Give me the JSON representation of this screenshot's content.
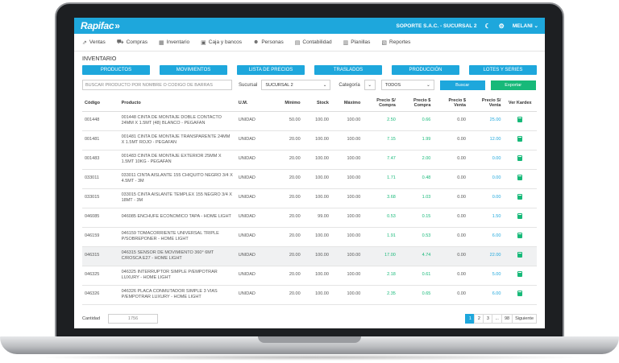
{
  "header": {
    "brand": "Rapifac",
    "company": "SOPORTE S.A.C. - SUCURSAL 2",
    "user": "MELANI"
  },
  "menu": [
    {
      "label": "Ventas",
      "icon": "chart-icon"
    },
    {
      "label": "Compras",
      "icon": "cart-icon"
    },
    {
      "label": "Inventario",
      "icon": "boxes-icon"
    },
    {
      "label": "Caja y bancos",
      "icon": "cash-icon"
    },
    {
      "label": "Personas",
      "icon": "people-icon"
    },
    {
      "label": "Contabilidad",
      "icon": "ledger-icon"
    },
    {
      "label": "Planillas",
      "icon": "sheet-icon"
    },
    {
      "label": "Reportes",
      "icon": "report-icon"
    }
  ],
  "section_title": "INVENTARIO",
  "tabs": [
    "PRODUCTOS",
    "MOVIMIENTOS",
    "LISTA DE PRECIOS",
    "TRASLADOS",
    "PRODUCCIÓN",
    "LOTES Y SERIES"
  ],
  "filters": {
    "search_placeholder": "BUSCAR PRODUCTO POR NOMBRE O CODIGO DE BARRAS",
    "sucursal_label": "Sucursal",
    "sucursal_value": "SUCURSAL 2",
    "categoria_label": "Categoría",
    "categoria_value": "TODOS",
    "buscar": "Buscar",
    "exportar": "Exportar"
  },
  "table": {
    "columns": [
      "Código",
      "Producto",
      "U.M.",
      "Mínimo",
      "Stock",
      "Máximo",
      "Precio S/ Compra",
      "Precio $ Compra",
      "Precio $ Venta",
      "Precio S/ Venta",
      "Ver Kardex"
    ],
    "rows": [
      {
        "codigo": "001448",
        "producto": "001448 CINTA DE MONTAJE DOBLE CONTACTO 24MM X 1.5MT (48) BLANCO - PEGAFAN",
        "um": "UNIDAD",
        "minimo": "50.00",
        "stock": "100.00",
        "maximo": "100.00",
        "pc_soles": "2.50",
        "pc_dolar": "0.66",
        "pv_dolar": "0.00",
        "pv_soles": "25.00"
      },
      {
        "codigo": "001481",
        "producto": "001481 CINTA DE MONTAJE TRANSPARENTE 24MM X 1.5MT ROJO - PEGAFAN",
        "um": "UNIDAD",
        "minimo": "20.00",
        "stock": "100.00",
        "maximo": "100.00",
        "pc_soles": "7.15",
        "pc_dolar": "1.99",
        "pv_dolar": "0.00",
        "pv_soles": "12.00"
      },
      {
        "codigo": "001483",
        "producto": "001483 CINTA DE MONTAJE EXTERIOR 25MM X 1.5MT 10KG - PEGAFAN",
        "um": "UNIDAD",
        "minimo": "20.00",
        "stock": "100.00",
        "maximo": "100.00",
        "pc_soles": "7.47",
        "pc_dolar": "2.00",
        "pv_dolar": "0.00",
        "pv_soles": "0.00"
      },
      {
        "codigo": "033011",
        "producto": "033011 CINTA AISLANTE 155 CHIQUITO NEGRO 3/4 X 4.5MT - 3M",
        "um": "UNIDAD",
        "minimo": "20.00",
        "stock": "100.00",
        "maximo": "100.00",
        "pc_soles": "1.71",
        "pc_dolar": "0.48",
        "pv_dolar": "0.00",
        "pv_soles": "0.00"
      },
      {
        "codigo": "033015",
        "producto": "033015 CINTA AISLANTE TEMPLEX 155 NEGRO 3/4 X 18MT - 3M",
        "um": "UNIDAD",
        "minimo": "20.00",
        "stock": "100.00",
        "maximo": "100.00",
        "pc_soles": "3.68",
        "pc_dolar": "1.03",
        "pv_dolar": "0.00",
        "pv_soles": "0.00"
      },
      {
        "codigo": "046085",
        "producto": "046085 ENCHUFE ECONOMICO TAPA - HOME LIGHT",
        "um": "UNIDAD",
        "minimo": "20.00",
        "stock": "99.00",
        "maximo": "100.00",
        "pc_soles": "0.53",
        "pc_dolar": "0.15",
        "pv_dolar": "0.00",
        "pv_soles": "1.50"
      },
      {
        "codigo": "046159",
        "producto": "046159 TOMACORRIENTE UNIVERSAL TRIPLE P/SOBREPONER - HOME LIGHT",
        "um": "UNIDAD",
        "minimo": "20.00",
        "stock": "100.00",
        "maximo": "100.00",
        "pc_soles": "1.91",
        "pc_dolar": "0.53",
        "pv_dolar": "0.00",
        "pv_soles": "6.00"
      },
      {
        "codigo": "046315",
        "producto": "046315 SENSOR DE MOVIMIENTO 360° 6MT C/ROSCA E27 - HOME LIGHT",
        "um": "UNIDAD",
        "minimo": "20.00",
        "stock": "100.00",
        "maximo": "100.00",
        "pc_soles": "17.00",
        "pc_dolar": "4.74",
        "pv_dolar": "0.00",
        "pv_soles": "22.00"
      },
      {
        "codigo": "046325",
        "producto": "046325 INTERRUPTOR SIMPLE P/EMPOTRAR LUXURY - HOME LIGHT",
        "um": "UNIDAD",
        "minimo": "20.00",
        "stock": "100.00",
        "maximo": "100.00",
        "pc_soles": "2.18",
        "pc_dolar": "0.61",
        "pv_dolar": "0.00",
        "pv_soles": "5.00"
      },
      {
        "codigo": "046326",
        "producto": "046326 PLACA CONMUTADOR SIMPLE 3 VIAS P/EMPOTRAR LUXURY - HOME LIGHT",
        "um": "UNIDAD",
        "minimo": "20.00",
        "stock": "100.00",
        "maximo": "100.00",
        "pc_soles": "2.35",
        "pc_dolar": "0.65",
        "pv_dolar": "0.00",
        "pv_soles": "6.00"
      }
    ],
    "highlighted_row": 7
  },
  "footer": {
    "cantidad_label": "Cantidad",
    "cantidad_value": "1756",
    "pages": [
      "1",
      "2",
      "3",
      "...",
      "98"
    ],
    "active_page": "1",
    "next_label": "Siguiente"
  },
  "colors": {
    "accent": "#1ea7dc",
    "success": "#17b979"
  }
}
